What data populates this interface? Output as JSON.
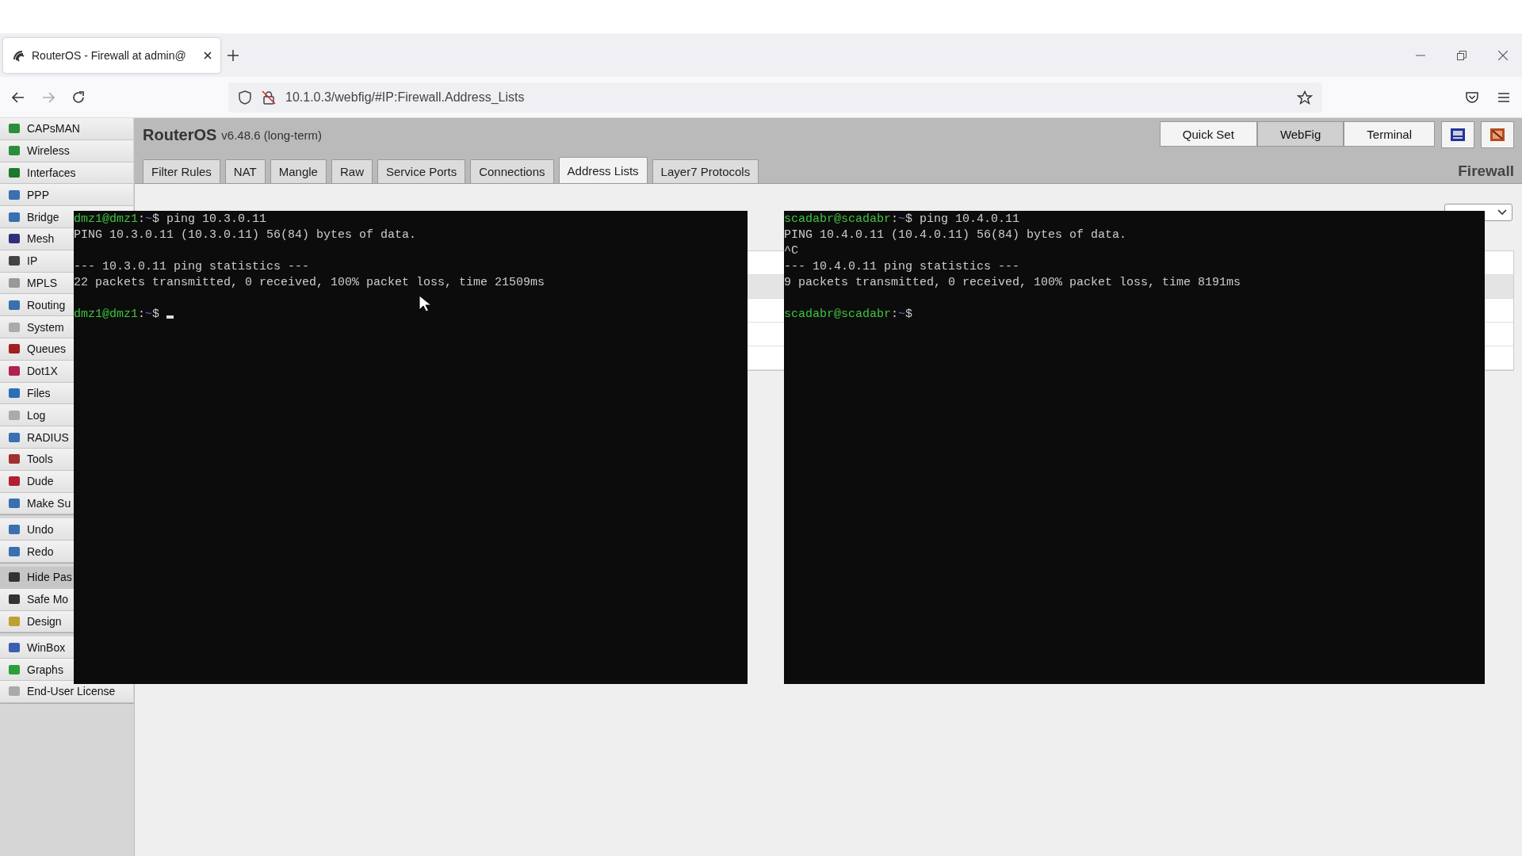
{
  "browser": {
    "tab": {
      "title": "RouterOS - Firewall at admin@",
      "selected": true
    },
    "address": "10.1.0.3/webfig/#IP:Firewall.Address_Lists"
  },
  "sidebar": {
    "groups": [
      {
        "items": [
          {
            "label": "CAPsMAN",
            "selected": false
          },
          {
            "label": "Wireless",
            "selected": false
          },
          {
            "label": "Interfaces",
            "selected": false
          },
          {
            "label": "PPP",
            "selected": false
          },
          {
            "label": "Bridge",
            "selected": false
          },
          {
            "label": "Mesh",
            "selected": false
          },
          {
            "label": "IP",
            "selected": false
          },
          {
            "label": "MPLS",
            "selected": false
          },
          {
            "label": "Routing",
            "selected": false
          },
          {
            "label": "System",
            "selected": false
          },
          {
            "label": "Queues",
            "selected": false
          },
          {
            "label": "Dot1X",
            "selected": false
          },
          {
            "label": "Files",
            "selected": false
          },
          {
            "label": "Log",
            "selected": false
          },
          {
            "label": "RADIUS",
            "selected": false
          },
          {
            "label": "Tools",
            "selected": false
          },
          {
            "label": "Dude",
            "selected": false
          },
          {
            "label": "Make Su",
            "selected": false
          }
        ]
      },
      {
        "items": [
          {
            "label": "Undo",
            "selected": false
          },
          {
            "label": "Redo",
            "selected": false
          }
        ]
      },
      {
        "items": [
          {
            "label": "Hide Pas",
            "selected": true
          },
          {
            "label": "Safe Mo",
            "selected": false
          },
          {
            "label": "Design",
            "selected": false
          }
        ]
      },
      {
        "items": [
          {
            "label": "WinBox",
            "selected": false
          },
          {
            "label": "Graphs",
            "selected": false
          },
          {
            "label": "End-User License",
            "selected": false
          }
        ]
      }
    ]
  },
  "header": {
    "product": "RouterOS",
    "version": "v6.48.6 (long-term)",
    "mode_buttons": [
      {
        "label": "Quick Set",
        "selected": false
      },
      {
        "label": "WebFig",
        "selected": true
      },
      {
        "label": "Terminal",
        "selected": false
      }
    ],
    "section": "Firewall",
    "tabs": [
      {
        "label": "Filter Rules",
        "selected": false
      },
      {
        "label": "NAT",
        "selected": false
      },
      {
        "label": "Mangle",
        "selected": false
      },
      {
        "label": "Raw",
        "selected": false
      },
      {
        "label": "Service Ports",
        "selected": false
      },
      {
        "label": "Connections",
        "selected": false
      },
      {
        "label": "Address Lists",
        "selected": true
      },
      {
        "label": "Layer7 Protocols",
        "selected": false
      }
    ]
  },
  "terminals": [
    {
      "lines": [
        {
          "kind": "prompt",
          "user": "dmz1@dmz1",
          "sep": ":",
          "dir": "~",
          "sign": "$",
          "command": " ping 10.3.0.11",
          "cursor": false
        },
        {
          "kind": "output",
          "text": "PING 10.3.0.11 (10.3.0.11) 56(84) bytes of data."
        },
        {
          "kind": "blank"
        },
        {
          "kind": "output",
          "text": "--- 10.3.0.11 ping statistics ---"
        },
        {
          "kind": "output",
          "text": "22 packets transmitted, 0 received, 100% packet loss, time 21509ms"
        },
        {
          "kind": "blank"
        },
        {
          "kind": "prompt",
          "user": "dmz1@dmz1",
          "sep": ":",
          "dir": "~",
          "sign": "$",
          "cursor": true
        }
      ]
    },
    {
      "lines": [
        {
          "kind": "prompt",
          "user": "scadabr@scadabr",
          "sep": ":",
          "dir": "~",
          "sign": "$",
          "command": " ping 10.4.0.11",
          "cursor": false
        },
        {
          "kind": "output",
          "text": "PING 10.4.0.11 (10.4.0.11) 56(84) bytes of data."
        },
        {
          "kind": "output",
          "text": "^C"
        },
        {
          "kind": "output",
          "text": "--- 10.4.0.11 ping statistics ---"
        },
        {
          "kind": "output",
          "text": "9 packets transmitted, 0 received, 100% packet loss, time 8191ms"
        },
        {
          "kind": "blank"
        },
        {
          "kind": "prompt",
          "user": "scadabr@scadabr",
          "sep": ":",
          "dir": "~",
          "sign": "$",
          "cursor": false
        }
      ]
    }
  ]
}
